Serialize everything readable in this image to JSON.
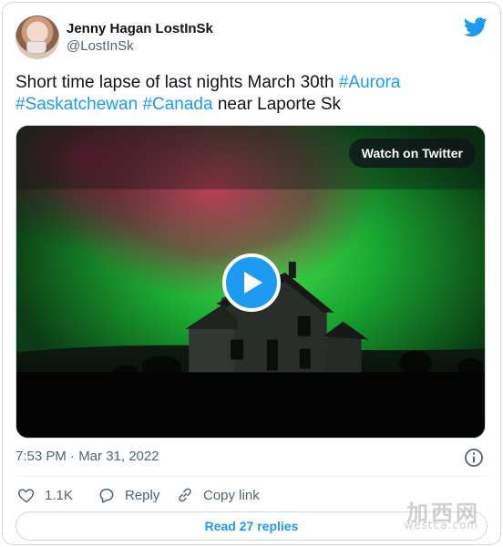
{
  "user": {
    "display_name": "Jenny Hagan LostInSk",
    "handle": "@LostInSk"
  },
  "tweet": {
    "text_before": "Short time lapse of last nights March 30th ",
    "hashtag_aurora": "#Aurora",
    "hashtag_saskatchewan": "#Saskatchewan",
    "hashtag_canada": "#Canada",
    "text_after": " near Laporte Sk"
  },
  "media": {
    "watch_label": "Watch on Twitter",
    "play_icon": "play-icon"
  },
  "meta": {
    "timestamp": "7:53 PM · Mar 31, 2022"
  },
  "actions": {
    "like_count": "1.1K",
    "reply_label": "Reply",
    "copy_label": "Copy link"
  },
  "read_replies_label": "Read 27 replies",
  "watermark": {
    "cn": "加西网",
    "url": "westca.com"
  },
  "colors": {
    "accent": "#1d9bf0",
    "text": "#0f1419",
    "muted": "#536471",
    "border": "#cfd9de"
  },
  "icons": [
    "twitter-bird-icon",
    "play-icon",
    "info-icon",
    "heart-icon",
    "reply-icon",
    "link-icon"
  ]
}
